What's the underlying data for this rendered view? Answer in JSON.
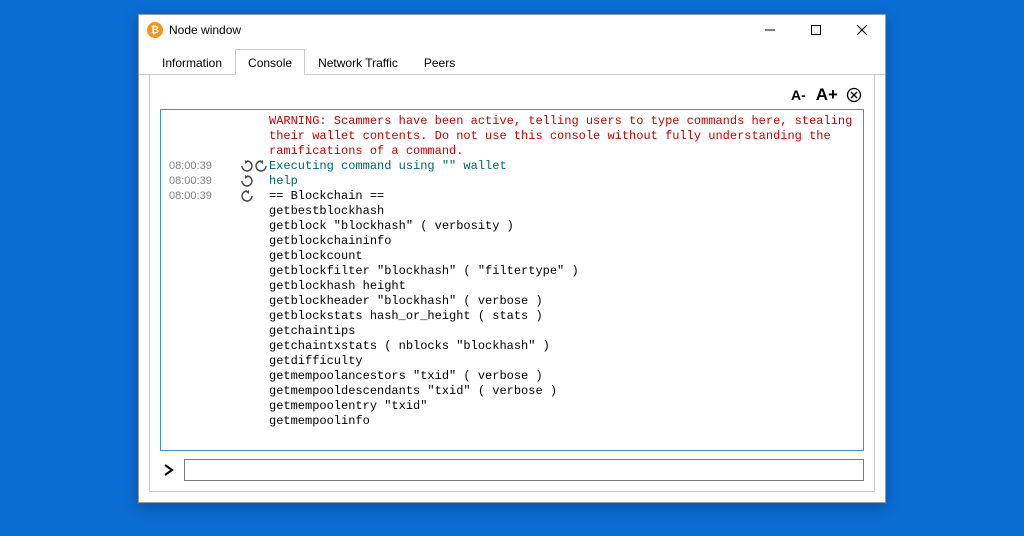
{
  "window": {
    "title": "Node window"
  },
  "tabs": [
    {
      "label": "Information"
    },
    {
      "label": "Console"
    },
    {
      "label": "Network Traffic"
    },
    {
      "label": "Peers"
    }
  ],
  "active_tab_index": 1,
  "toolbar": {
    "font_decrease": "A-",
    "font_increase": "A+"
  },
  "warning": "WARNING: Scammers have been active, telling users to type commands here, stealing their wallet contents. Do not use this console without fully understanding the ramifications of a command.",
  "log": [
    {
      "ts": "08:00:39",
      "kind": "exec",
      "text": "Executing command using \"\" wallet"
    },
    {
      "ts": "08:00:39",
      "kind": "input",
      "text": "help"
    },
    {
      "ts": "08:00:39",
      "kind": "output",
      "text": "== Blockchain ==\ngetbestblockhash\ngetblock \"blockhash\" ( verbosity )\ngetblockchaininfo\ngetblockcount\ngetblockfilter \"blockhash\" ( \"filtertype\" )\ngetblockhash height\ngetblockheader \"blockhash\" ( verbose )\ngetblockstats hash_or_height ( stats )\ngetchaintips\ngetchaintxstats ( nblocks \"blockhash\" )\ngetdifficulty\ngetmempoolancestors \"txid\" ( verbose )\ngetmempooldescendants \"txid\" ( verbose )\ngetmempoolentry \"txid\"\ngetmempoolinfo"
    }
  ],
  "input": {
    "placeholder": ""
  }
}
